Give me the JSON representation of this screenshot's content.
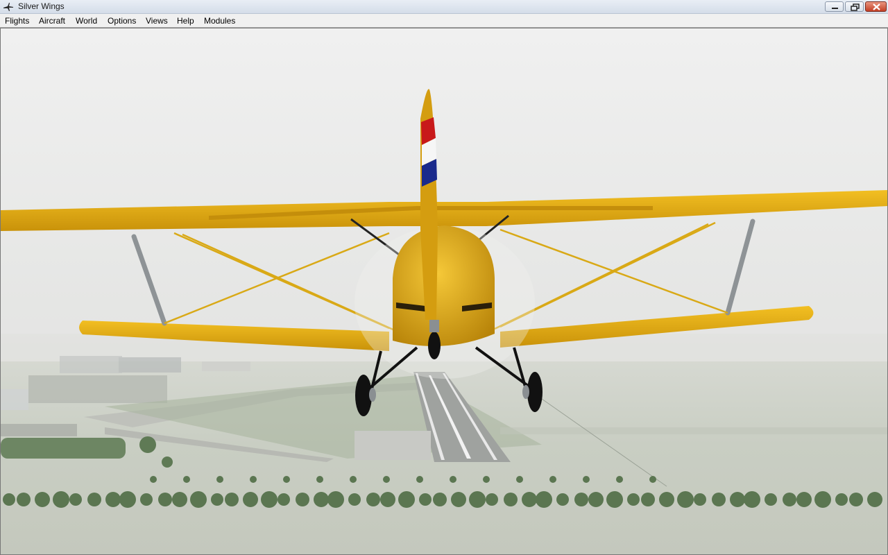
{
  "window": {
    "title": "Silver Wings",
    "app_icon": "airplane-icon",
    "controls": [
      "minimize-icon",
      "restore-icon",
      "close-icon"
    ]
  },
  "menu": {
    "items": [
      "Flights",
      "Aircraft",
      "World",
      "Options",
      "Views",
      "Help",
      "Modules"
    ]
  },
  "scene": {
    "aircraft_color": "#e8b213",
    "sky_color": "#ededed",
    "ground_color": "#cfd3ca"
  }
}
